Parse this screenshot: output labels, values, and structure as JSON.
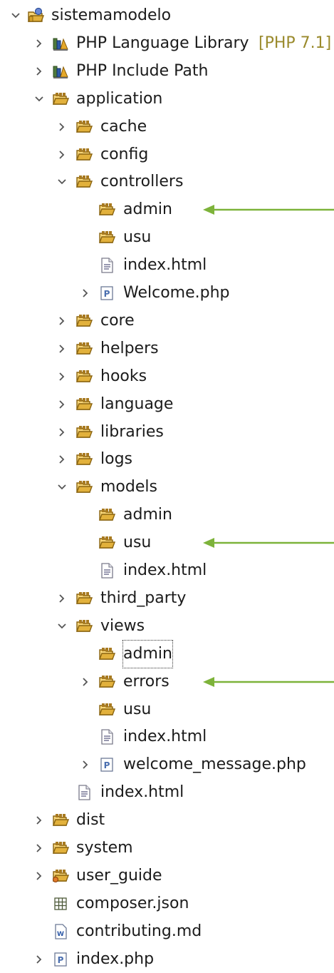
{
  "tree": {
    "rows": [
      {
        "label": "sistemamodelo",
        "icon": "php-project-icon",
        "toggle": "expanded",
        "depth": 0
      },
      {
        "label": "PHP Language Library",
        "decoration": "[PHP 7.1]",
        "icon": "library-icon",
        "toggle": "collapsed",
        "depth": 1
      },
      {
        "label": "PHP Include Path",
        "icon": "library-icon",
        "toggle": "collapsed",
        "depth": 1
      },
      {
        "label": "application",
        "icon": "folder-icon",
        "toggle": "expanded",
        "depth": 1
      },
      {
        "label": "cache",
        "icon": "folder-icon",
        "toggle": "collapsed",
        "depth": 2
      },
      {
        "label": "config",
        "icon": "folder-icon",
        "toggle": "collapsed",
        "depth": 2
      },
      {
        "label": "controllers",
        "icon": "folder-icon",
        "toggle": "expanded",
        "depth": 2
      },
      {
        "label": "admin",
        "icon": "folder-icon",
        "toggle": "none",
        "depth": 3
      },
      {
        "label": "usu",
        "icon": "folder-icon",
        "toggle": "none",
        "depth": 3
      },
      {
        "label": "index.html",
        "icon": "html-file-icon",
        "toggle": "none",
        "depth": 3
      },
      {
        "label": "Welcome.php",
        "icon": "php-file-icon",
        "toggle": "collapsed",
        "depth": 3
      },
      {
        "label": "core",
        "icon": "folder-icon",
        "toggle": "collapsed",
        "depth": 2
      },
      {
        "label": "helpers",
        "icon": "folder-icon",
        "toggle": "collapsed",
        "depth": 2
      },
      {
        "label": "hooks",
        "icon": "folder-icon",
        "toggle": "collapsed",
        "depth": 2
      },
      {
        "label": "language",
        "icon": "folder-icon",
        "toggle": "collapsed",
        "depth": 2
      },
      {
        "label": "libraries",
        "icon": "folder-icon",
        "toggle": "collapsed",
        "depth": 2
      },
      {
        "label": "logs",
        "icon": "folder-icon",
        "toggle": "collapsed",
        "depth": 2
      },
      {
        "label": "models",
        "icon": "folder-icon",
        "toggle": "expanded",
        "depth": 2
      },
      {
        "label": "admin",
        "icon": "folder-icon",
        "toggle": "none",
        "depth": 3
      },
      {
        "label": "usu",
        "icon": "folder-icon",
        "toggle": "none",
        "depth": 3
      },
      {
        "label": "index.html",
        "icon": "html-file-icon",
        "toggle": "none",
        "depth": 3
      },
      {
        "label": "third_party",
        "icon": "folder-icon",
        "toggle": "collapsed",
        "depth": 2
      },
      {
        "label": "views",
        "icon": "folder-icon",
        "toggle": "expanded",
        "depth": 2
      },
      {
        "label": "admin",
        "icon": "folder-icon",
        "toggle": "none",
        "depth": 3,
        "focused": true
      },
      {
        "label": "errors",
        "icon": "folder-icon",
        "toggle": "collapsed",
        "depth": 3
      },
      {
        "label": "usu",
        "icon": "folder-icon",
        "toggle": "none",
        "depth": 3
      },
      {
        "label": "index.html",
        "icon": "html-file-icon",
        "toggle": "none",
        "depth": 3
      },
      {
        "label": "welcome_message.php",
        "icon": "php-file-icon",
        "toggle": "collapsed",
        "depth": 3
      },
      {
        "label": "index.html",
        "icon": "html-file-icon",
        "toggle": "none",
        "depth": 2
      },
      {
        "label": "dist",
        "icon": "folder-icon",
        "toggle": "collapsed",
        "depth": 1
      },
      {
        "label": "system",
        "icon": "folder-icon",
        "toggle": "collapsed",
        "depth": 1
      },
      {
        "label": "user_guide",
        "icon": "special-folder-icon",
        "toggle": "collapsed",
        "depth": 1
      },
      {
        "label": "composer.json",
        "icon": "json-file-icon",
        "toggle": "none",
        "depth": 1
      },
      {
        "label": "contributing.md",
        "icon": "markdown-file-icon",
        "toggle": "none",
        "depth": 1
      },
      {
        "label": "index.php",
        "icon": "php-file-icon",
        "toggle": "collapsed",
        "depth": 1
      }
    ]
  },
  "annotations": {
    "arrows": [
      {
        "name": "annotation-arrow-controllers-admin",
        "points_to_row": 7
      },
      {
        "name": "annotation-arrow-models",
        "points_to_row": 19
      },
      {
        "name": "annotation-arrow-views",
        "points_to_row": 24
      }
    ],
    "arrow_color": "#7db33a"
  },
  "colors": {
    "folder": "#e2b13c",
    "folder_dark": "#8a6410",
    "toggle": "#555555",
    "decoration": "#9a8a2c",
    "php_file": "#4a6fb0",
    "html_file": "#6b6b8f"
  }
}
